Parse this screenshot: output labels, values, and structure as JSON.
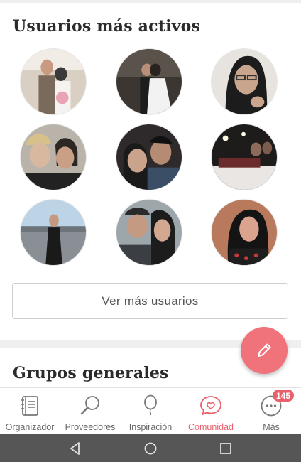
{
  "top_section": {
    "title": "Usuarios más activos",
    "users": [
      {
        "name": "wedding-couple-flowers-avatar",
        "colors": [
          "#d9cfc2",
          "#3a3a3a",
          "#e8a4b4"
        ]
      },
      {
        "name": "wedding-couple-dark-avatar",
        "colors": [
          "#3b3632",
          "#1d1d1d",
          "#f2f2f2"
        ]
      },
      {
        "name": "woman-glasses-avatar",
        "colors": [
          "#e7e4e0",
          "#1c1c1c",
          "#c9a58d"
        ]
      },
      {
        "name": "couple-selfie-avatar",
        "colors": [
          "#b9b3aa",
          "#2b2722",
          "#d9b8a0"
        ]
      },
      {
        "name": "couple-selfie-dark-avatar",
        "colors": [
          "#2e2a2c",
          "#1a1a1a",
          "#caa38c"
        ]
      },
      {
        "name": "restaurant-table-avatar",
        "colors": [
          "#1e1b1b",
          "#6b2b2b",
          "#e9e6e4"
        ]
      },
      {
        "name": "woman-canal-avatar",
        "colors": [
          "#bcd4e6",
          "#2b2b2b",
          "#8a8f95"
        ]
      },
      {
        "name": "couple-cap-avatar",
        "colors": [
          "#9da6ab",
          "#2a2a2a",
          "#c59a82"
        ]
      },
      {
        "name": "woman-red-top-avatar",
        "colors": [
          "#b9795c",
          "#141414",
          "#d9a38e"
        ]
      }
    ],
    "more_button": "Ver más usuarios"
  },
  "bottom_section": {
    "title": "Grupos generales"
  },
  "nav": {
    "items": [
      {
        "label": "Organizador",
        "icon": "planner-icon"
      },
      {
        "label": "Proveedores",
        "icon": "magnifier-icon"
      },
      {
        "label": "Inspiración",
        "icon": "balloon-icon"
      },
      {
        "label": "Comunidad",
        "icon": "chat-heart-icon",
        "active": true
      },
      {
        "label": "Más",
        "icon": "more-icon",
        "badge": "145"
      }
    ]
  },
  "colors": {
    "accent": "#e8606b",
    "fab": "#f0727a",
    "system_bar": "#565656"
  }
}
